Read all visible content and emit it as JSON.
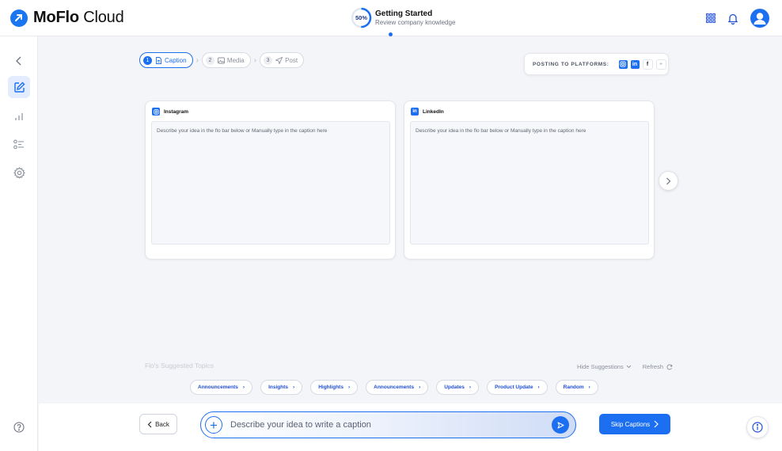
{
  "app": {
    "name_bold": "MoFlo",
    "name_rest": " Cloud"
  },
  "onboarding": {
    "percent_label": "50%",
    "percent": 0.5,
    "title": "Getting Started",
    "subtitle": "Review company knowledge"
  },
  "stepper": {
    "steps": [
      {
        "num": "1",
        "label": "Caption",
        "icon": "document-icon",
        "active": true
      },
      {
        "num": "2",
        "label": "Media",
        "icon": "image-icon",
        "active": false
      },
      {
        "num": "3",
        "label": "Post",
        "icon": "send-icon",
        "active": false
      }
    ]
  },
  "platforms": {
    "label": "POSTING TO PLATFORMS:",
    "items": [
      {
        "name": "instagram",
        "icon": "instagram-icon",
        "color": "#1d6ff2"
      },
      {
        "name": "linkedin",
        "icon": "linkedin-icon",
        "glyph": "in",
        "color": "#1d6ff2"
      },
      {
        "name": "facebook",
        "icon": "facebook-icon",
        "glyph": "f"
      },
      {
        "name": "more",
        "icon": "more-icon",
        "glyph": "+"
      }
    ]
  },
  "cards": [
    {
      "platform": "Instagram",
      "placeholder": "Describe your idea in the flo bar below or Manually type in the caption here"
    },
    {
      "platform": "LinkedIn",
      "glyph": "in",
      "placeholder": "Describe your idea in the flo bar below or Manually type in the caption here"
    }
  ],
  "suggestions": {
    "title": "Flo's Suggested Topics",
    "hide_label": "Hide Suggestions",
    "refresh_label": "Refresh",
    "chips": [
      "Announcements",
      "Insights",
      "Highlights",
      "Announcements",
      "Updates",
      "Product Update",
      "Random"
    ]
  },
  "bottom": {
    "back_label": "Back",
    "input_placeholder": "Describe your idea to write a caption",
    "skip_label": "Skip Captions"
  },
  "colors": {
    "accent": "#1d6ff2"
  }
}
